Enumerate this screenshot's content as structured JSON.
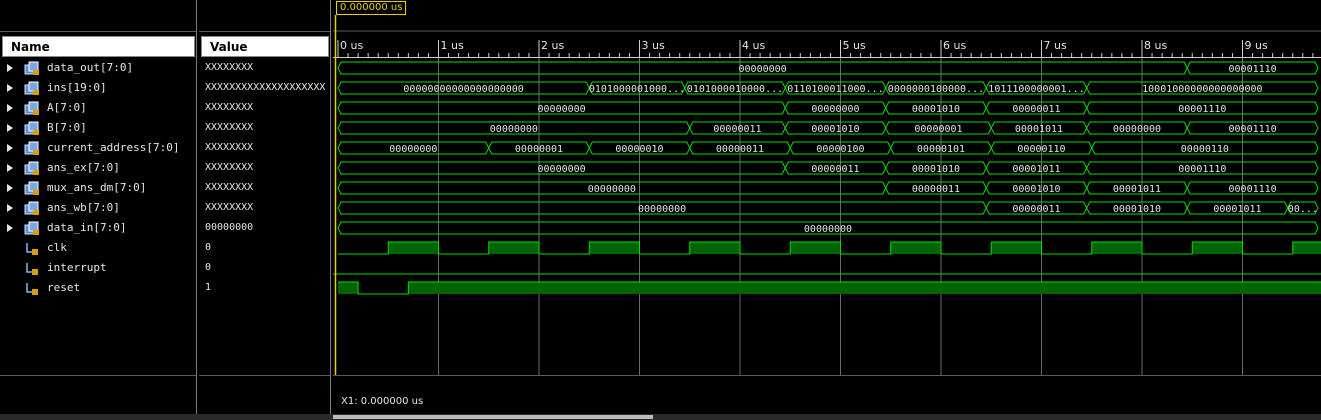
{
  "columns": {
    "name": "Name",
    "value": "Value"
  },
  "cursor": {
    "time_label": "0.000000 us",
    "readout": "X1: 0.000000 us"
  },
  "colors": {
    "wave": "#00e000",
    "grid": "#6a6a6a",
    "cursor": "#e8d000",
    "clock_fill": "#006400"
  },
  "timeline": {
    "start_us": 0,
    "end_us": 9.8,
    "ticks": [
      "0 us",
      "1 us",
      "2 us",
      "3 us",
      "4 us",
      "5 us",
      "6 us",
      "7 us",
      "8 us",
      "9 us"
    ]
  },
  "signals": [
    {
      "name": "data_out[7:0]",
      "value": "XXXXXXXX",
      "type": "bus",
      "segments": [
        {
          "t0": 0,
          "t1": 8.45,
          "label": "00000000"
        },
        {
          "t0": 8.45,
          "t1": 9.8,
          "label": "00001110"
        }
      ]
    },
    {
      "name": "ins[19:0]",
      "value": "XXXXXXXXXXXXXXXXXXXX",
      "type": "bus",
      "segments": [
        {
          "t0": 0,
          "t1": 2.5,
          "label": "00000000000000000000"
        },
        {
          "t0": 2.5,
          "t1": 3.45,
          "label": "0101000001000..."
        },
        {
          "t0": 3.45,
          "t1": 4.45,
          "label": "0101000010000..."
        },
        {
          "t0": 4.45,
          "t1": 5.45,
          "label": "0110100011000..."
        },
        {
          "t0": 5.45,
          "t1": 6.45,
          "label": "0000000100000..."
        },
        {
          "t0": 6.45,
          "t1": 7.45,
          "label": "1011100000001..."
        },
        {
          "t0": 7.45,
          "t1": 9.8,
          "label": "10001000000000000000"
        }
      ]
    },
    {
      "name": "A[7:0]",
      "value": "XXXXXXXX",
      "type": "bus",
      "segments": [
        {
          "t0": 0,
          "t1": 4.45,
          "label": "00000000"
        },
        {
          "t0": 4.45,
          "t1": 5.45,
          "label": "00000000"
        },
        {
          "t0": 5.45,
          "t1": 6.45,
          "label": "00001010"
        },
        {
          "t0": 6.45,
          "t1": 7.45,
          "label": "00000011"
        },
        {
          "t0": 7.45,
          "t1": 9.8,
          "label": "00001110"
        }
      ]
    },
    {
      "name": "B[7:0]",
      "value": "XXXXXXXX",
      "type": "bus",
      "segments": [
        {
          "t0": 0,
          "t1": 3.5,
          "label": "00000000"
        },
        {
          "t0": 3.5,
          "t1": 4.45,
          "label": "00000011"
        },
        {
          "t0": 4.45,
          "t1": 5.45,
          "label": "00001010"
        },
        {
          "t0": 5.45,
          "t1": 6.5,
          "label": "00000001"
        },
        {
          "t0": 6.5,
          "t1": 7.45,
          "label": "00001011"
        },
        {
          "t0": 7.45,
          "t1": 8.45,
          "label": "00000000"
        },
        {
          "t0": 8.45,
          "t1": 9.8,
          "label": "00001110"
        }
      ]
    },
    {
      "name": "current_address[7:0]",
      "value": "XXXXXXXX",
      "type": "bus",
      "segments": [
        {
          "t0": 0,
          "t1": 1.5,
          "label": "00000000"
        },
        {
          "t0": 1.5,
          "t1": 2.5,
          "label": "00000001"
        },
        {
          "t0": 2.5,
          "t1": 3.5,
          "label": "00000010"
        },
        {
          "t0": 3.5,
          "t1": 4.5,
          "label": "00000011"
        },
        {
          "t0": 4.5,
          "t1": 5.5,
          "label": "00000100"
        },
        {
          "t0": 5.5,
          "t1": 6.5,
          "label": "00000101"
        },
        {
          "t0": 6.5,
          "t1": 7.5,
          "label": "00000110"
        },
        {
          "t0": 7.5,
          "t1": 9.8,
          "label": "00000110"
        }
      ]
    },
    {
      "name": "ans_ex[7:0]",
      "value": "XXXXXXXX",
      "type": "bus",
      "segments": [
        {
          "t0": 0,
          "t1": 4.45,
          "label": "00000000"
        },
        {
          "t0": 4.45,
          "t1": 5.45,
          "label": "00000011"
        },
        {
          "t0": 5.45,
          "t1": 6.45,
          "label": "00001010"
        },
        {
          "t0": 6.45,
          "t1": 7.45,
          "label": "00001011"
        },
        {
          "t0": 7.45,
          "t1": 9.8,
          "label": "00001110"
        }
      ]
    },
    {
      "name": "mux_ans_dm[7:0]",
      "value": "XXXXXXXX",
      "type": "bus",
      "segments": [
        {
          "t0": 0,
          "t1": 5.45,
          "label": "00000000"
        },
        {
          "t0": 5.45,
          "t1": 6.45,
          "label": "00000011"
        },
        {
          "t0": 6.45,
          "t1": 7.45,
          "label": "00001010"
        },
        {
          "t0": 7.45,
          "t1": 8.45,
          "label": "00001011"
        },
        {
          "t0": 8.45,
          "t1": 9.8,
          "label": "00001110"
        }
      ]
    },
    {
      "name": "ans_wb[7:0]",
      "value": "XXXXXXXX",
      "type": "bus",
      "segments": [
        {
          "t0": 0,
          "t1": 6.45,
          "label": "00000000"
        },
        {
          "t0": 6.45,
          "t1": 7.45,
          "label": "00000011"
        },
        {
          "t0": 7.45,
          "t1": 8.45,
          "label": "00001010"
        },
        {
          "t0": 8.45,
          "t1": 9.45,
          "label": "00001011"
        },
        {
          "t0": 9.45,
          "t1": 9.8,
          "label": "00..."
        }
      ]
    },
    {
      "name": "data_in[7:0]",
      "value": "00000000",
      "type": "bus",
      "segments": [
        {
          "t0": 0,
          "t1": 9.8,
          "label": "00000000"
        }
      ]
    },
    {
      "name": "clk",
      "value": "0",
      "type": "clock",
      "period_us": 1.0,
      "first_rise_us": 0.5
    },
    {
      "name": "interrupt",
      "value": "0",
      "type": "bit",
      "level": 0
    },
    {
      "name": "reset",
      "value": "1",
      "type": "reset",
      "low_from_us": 0.2,
      "low_to_us": 0.7
    }
  ]
}
